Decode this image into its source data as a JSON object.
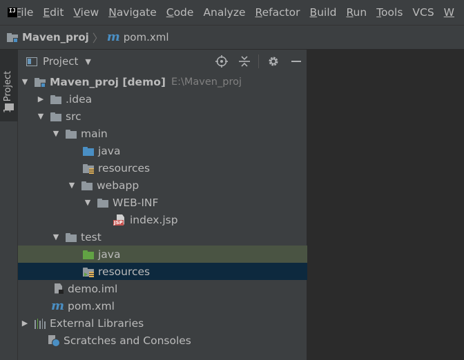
{
  "menubar": {
    "items": [
      {
        "mnemonic": "F",
        "rest": "ile"
      },
      {
        "mnemonic": "E",
        "rest": "dit"
      },
      {
        "mnemonic": "V",
        "rest": "iew"
      },
      {
        "mnemonic": "N",
        "rest": "avigate"
      },
      {
        "mnemonic": "C",
        "rest": "ode"
      },
      {
        "mnemonic": "",
        "rest": "Analyze"
      },
      {
        "mnemonic": "R",
        "rest": "efactor"
      },
      {
        "mnemonic": "B",
        "rest": "uild"
      },
      {
        "mnemonic": "R",
        "rest": "un"
      },
      {
        "mnemonic": "T",
        "rest": "ools"
      },
      {
        "mnemonic": "",
        "rest": "VCS"
      },
      {
        "mnemonic": "W",
        "rest": ""
      }
    ]
  },
  "breadcrumb": {
    "project": "Maven_proj",
    "file": "pom.xml",
    "separator": "〉"
  },
  "toolstrip": {
    "project_tab": "1: Project"
  },
  "panel": {
    "title": "Project",
    "caret": "▼"
  },
  "tree": {
    "root": {
      "label": "Maven_proj [demo]",
      "hint": "E:\\Maven_proj"
    },
    "idea": ".idea",
    "src": "src",
    "main": "main",
    "main_java": "java",
    "main_resources": "resources",
    "webapp": "webapp",
    "webinf": "WEB-INF",
    "index_jsp": "index.jsp",
    "test": "test",
    "test_java": "java",
    "test_resources": "resources",
    "demo_iml": "demo.iml",
    "pom_xml": "pom.xml",
    "external_libraries": "External Libraries",
    "scratches": "Scratches and Consoles"
  },
  "icons": {
    "jsp_tag": "JSP",
    "maven": "m"
  },
  "colors": {
    "selected_green": "#4a5443",
    "selected_blue": "#0d293e",
    "source_folder": "#4a8fc4",
    "test_folder": "#62a344"
  }
}
